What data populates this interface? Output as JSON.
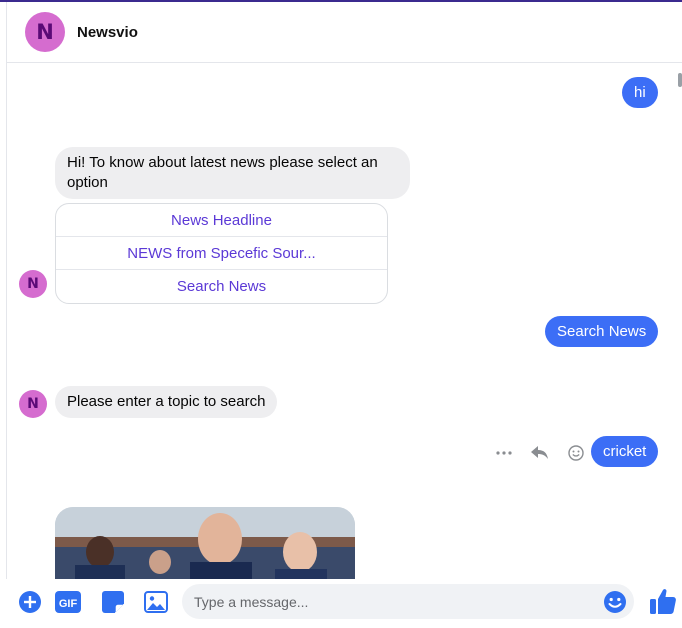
{
  "header": {
    "avatar_initial": "N",
    "page_name": "Newsvio"
  },
  "messages": {
    "out_hi": "hi",
    "bot_greeting": "Hi! To know about latest news please select an option",
    "quick_replies": [
      "News Headline",
      "NEWS from Specefic Sour...",
      "Search News"
    ],
    "out_search_news": "Search News",
    "bot_prompt": "Please enter a topic to search",
    "out_cricket": "cricket",
    "bot_avatar_initial": "N"
  },
  "composer": {
    "placeholder": "Type a message..."
  },
  "colors": {
    "outgoing_bubble": "#3c6ef6",
    "incoming_bubble": "#eeeef0",
    "avatar": "#d56ccf",
    "quick_reply_text": "#5b39d6",
    "icon_blue": "#2f6ff0"
  },
  "icons": [
    "plus-circle-icon",
    "gif-icon",
    "sticker-icon",
    "image-icon",
    "emoji-icon",
    "thumbs-up-icon",
    "more-icon",
    "reply-icon",
    "react-icon"
  ]
}
